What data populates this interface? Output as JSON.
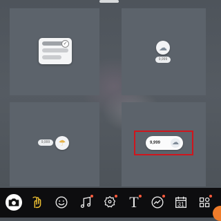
{
  "stickers": {
    "top_right_count": "9,999",
    "left_count": "9,999",
    "weather_value": "9,999"
  },
  "toolbar": {
    "calendar_day": "31",
    "text_tool_label": "T",
    "items": [
      "camera",
      "gesture",
      "emoji",
      "music",
      "location",
      "text",
      "drawing",
      "calendar",
      "grid"
    ]
  },
  "colors": {
    "highlight": "#d0151c",
    "notification_dot": "#ff5a3c",
    "gesture_accent": "#f1c232"
  }
}
